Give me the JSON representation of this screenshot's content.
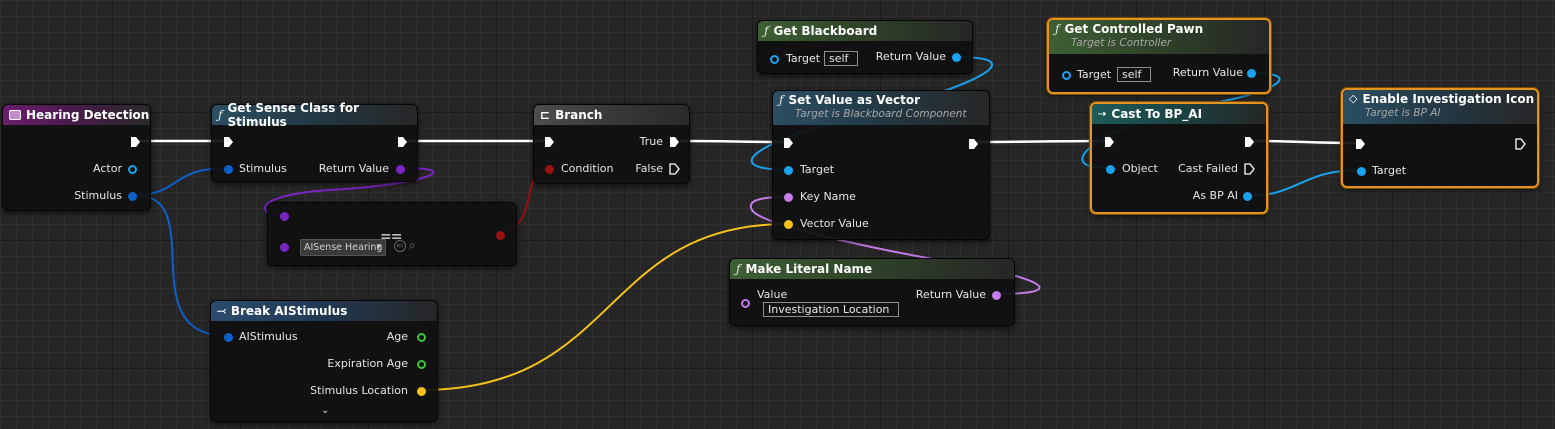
{
  "nodes": {
    "hearing_detection": {
      "title": "Hearing Detection",
      "pins": {
        "actor": "Actor",
        "stimulus": "Stimulus"
      }
    },
    "get_sense_class": {
      "title": "Get Sense Class for Stimulus",
      "pins": {
        "stimulus": "Stimulus",
        "return_value": "Return Value"
      }
    },
    "sense_select": {
      "value": "AISense Hearing"
    },
    "branch": {
      "title": "Branch",
      "pins": {
        "condition": "Condition",
        "true": "True",
        "false": "False"
      }
    },
    "break_stimulus": {
      "title": "Break AIStimulus",
      "pins": {
        "aistimulus": "AIStimulus",
        "age": "Age",
        "expiration_age": "Expiration Age",
        "stimulus_location": "Stimulus Location"
      }
    },
    "get_blackboard": {
      "title": "Get Blackboard",
      "pins": {
        "target": "Target",
        "target_default": "self",
        "return_value": "Return Value"
      }
    },
    "set_value_vector": {
      "title": "Set Value as Vector",
      "subtitle": "Target is Blackboard Component",
      "pins": {
        "target": "Target",
        "key_name": "Key Name",
        "vector_value": "Vector Value"
      }
    },
    "make_literal_name": {
      "title": "Make Literal Name",
      "pins": {
        "value": "Value",
        "value_default": "Investigation Location",
        "return_value": "Return Value"
      }
    },
    "get_controlled_pawn": {
      "title": "Get Controlled Pawn",
      "subtitle": "Target is Controller",
      "pins": {
        "target": "Target",
        "target_default": "self",
        "return_value": "Return Value"
      }
    },
    "cast_to_bp_ai": {
      "title": "Cast To BP_AI",
      "pins": {
        "object": "Object",
        "cast_failed": "Cast Failed",
        "as_bp_ai": "As BP AI"
      }
    },
    "enable_icon": {
      "title": "Enable Investigation Icon",
      "subtitle": "Target is BP AI",
      "pins": {
        "target": "Target"
      }
    }
  },
  "colors": {
    "exec": "#ffffff",
    "object": "#1aa3f0",
    "struct": "#0d5fc9",
    "class": "#7c23c4",
    "name": "#c67cea",
    "vector": "#f5c21b",
    "bool": "#9b1010",
    "float": "#39c439",
    "selection": "#e3941f"
  }
}
